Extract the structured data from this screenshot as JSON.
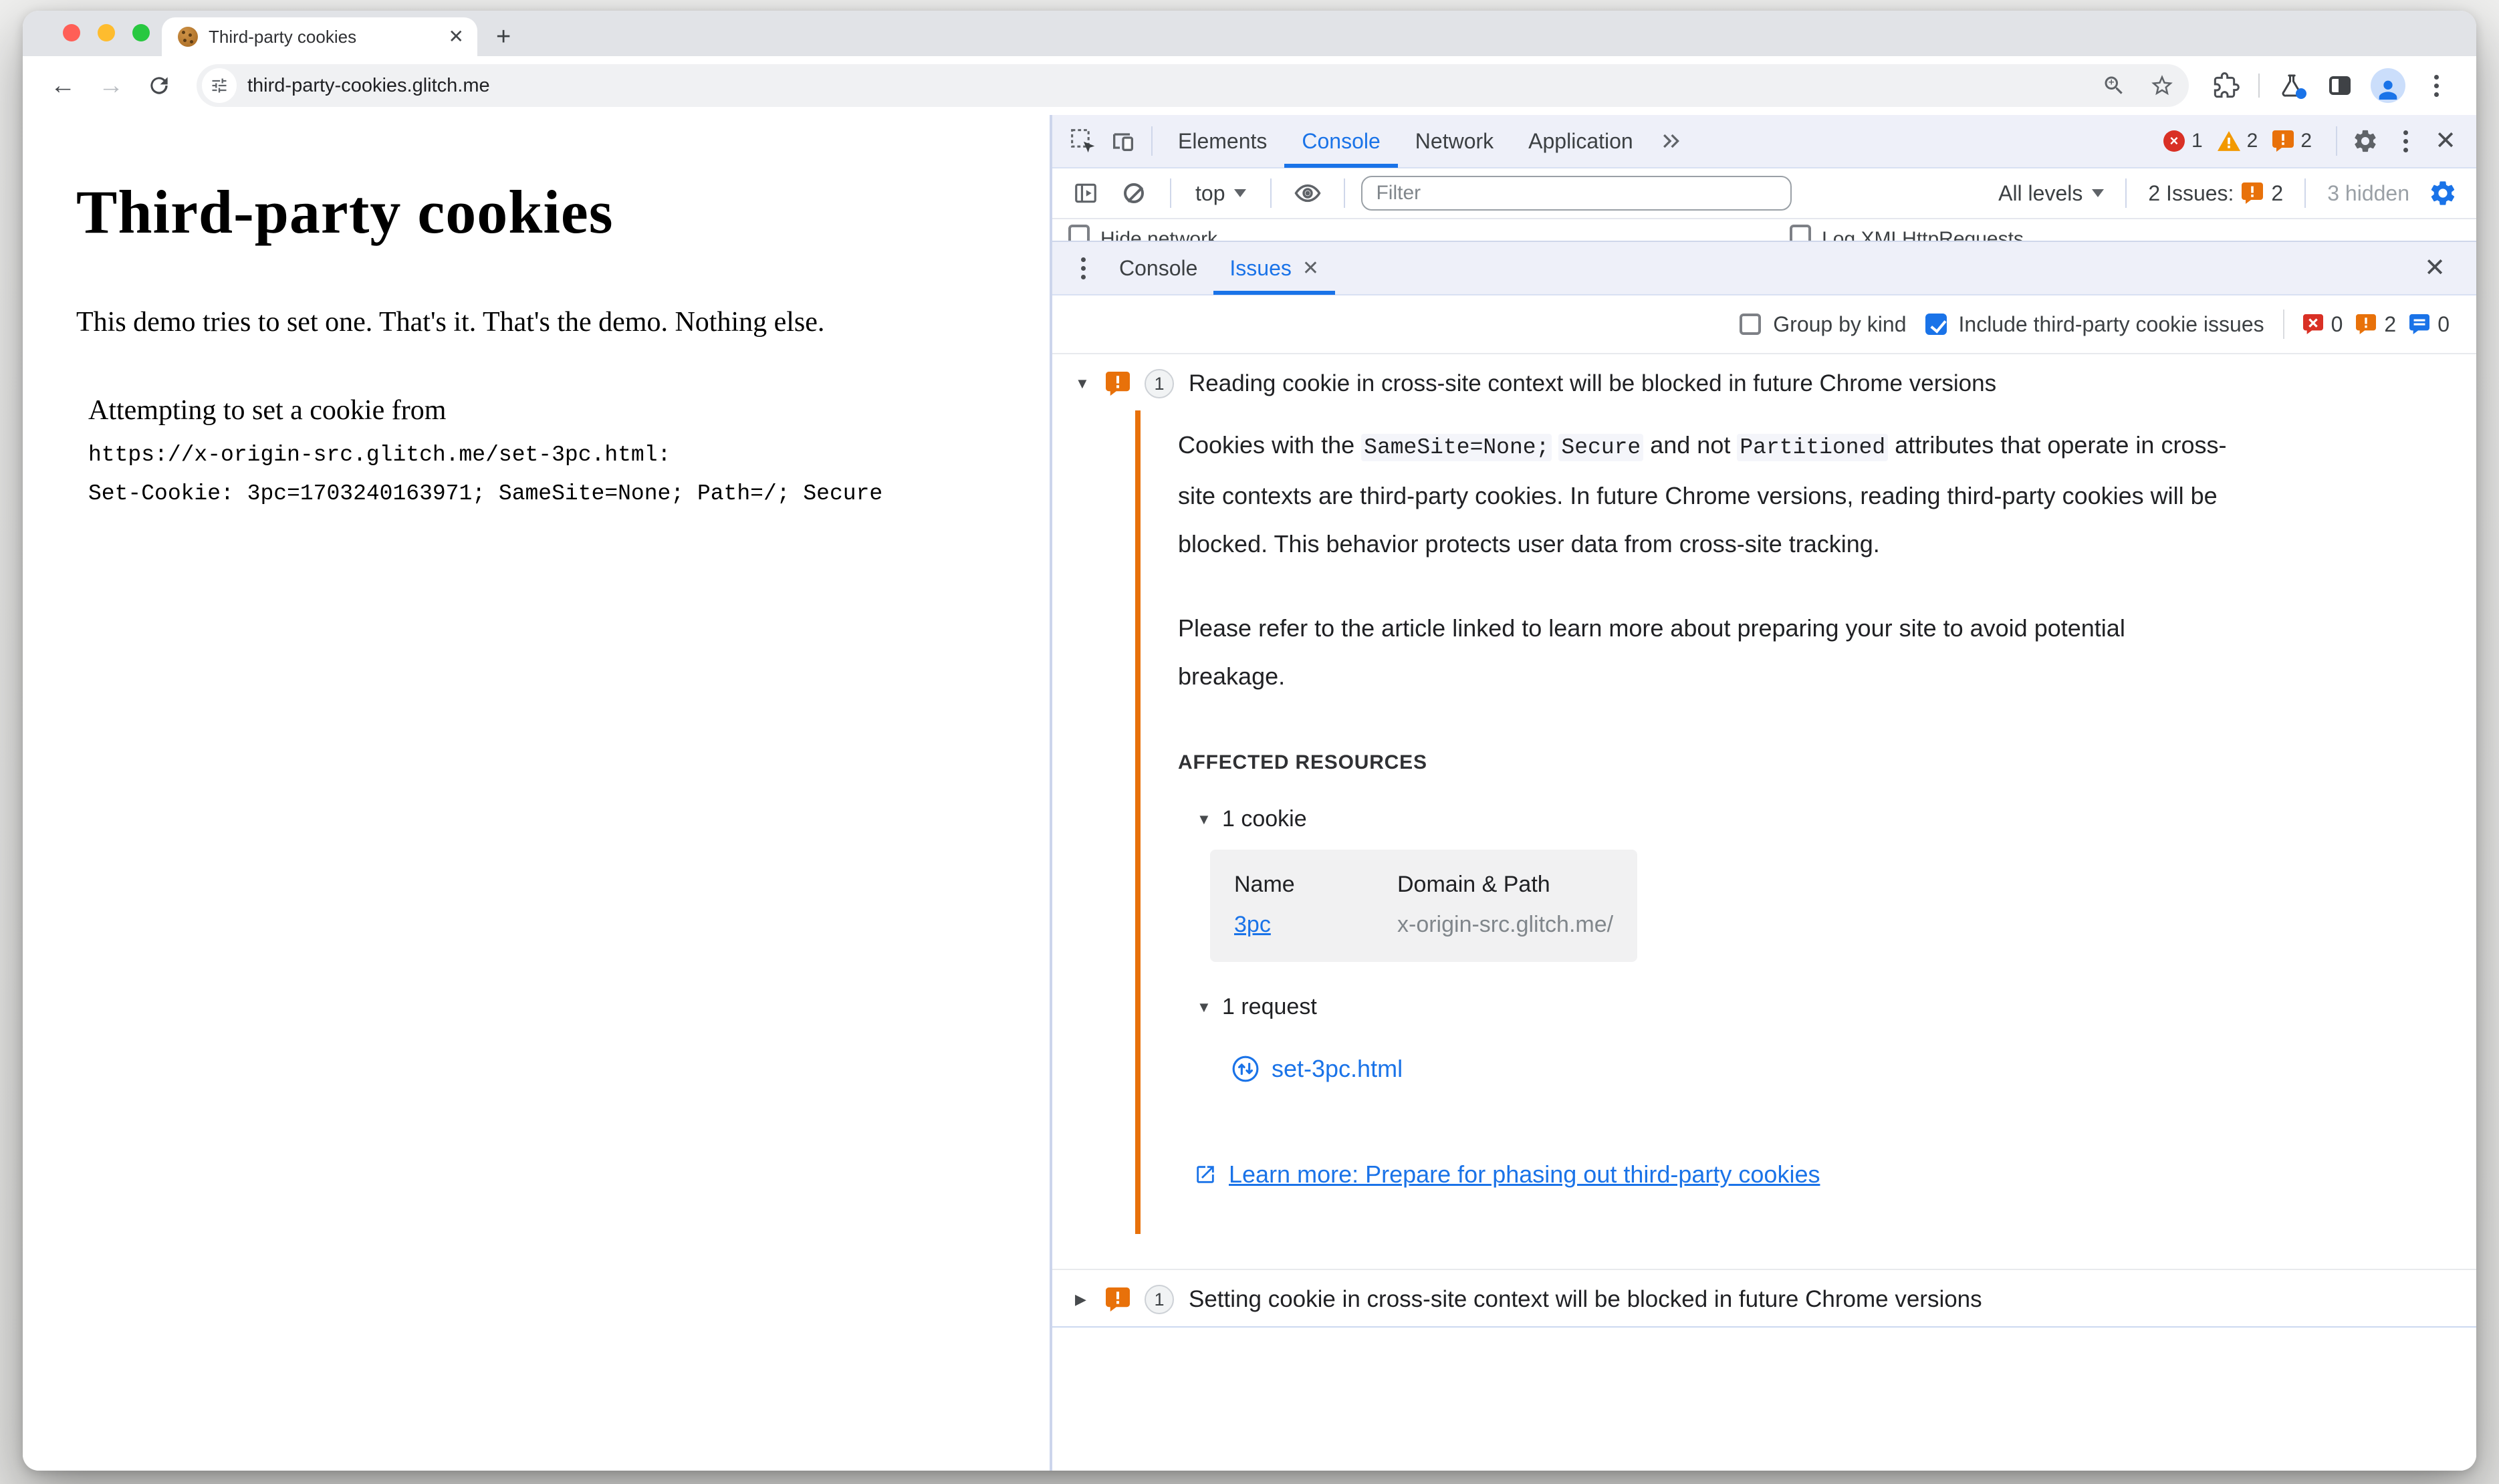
{
  "browser": {
    "tab_title": "Third-party cookies",
    "new_tab_label": "+",
    "tab_close_label": "✕",
    "url": "third-party-cookies.glitch.me",
    "back_arrow": "←",
    "forward_arrow": "→"
  },
  "page": {
    "heading": "Third-party cookies",
    "intro": "This demo tries to set one. That's it. That's the demo. Nothing else.",
    "attempt_label": "Attempting to set a cookie from",
    "attempt_url": "https://x-origin-src.glitch.me/set-3pc.html:",
    "set_cookie_line": "Set-Cookie: 3pc=1703240163971; SameSite=None; Path=/; Secure"
  },
  "devtools": {
    "tabs": [
      "Elements",
      "Console",
      "Network",
      "Application"
    ],
    "selected_tab": "Console",
    "badge_counts": {
      "errors": "1",
      "warnings": "2",
      "issues": "2"
    },
    "close_label": "✕",
    "console_toolbar": {
      "context": "top",
      "filter_placeholder": "Filter",
      "levels": "All levels",
      "issues_label": "2 Issues:",
      "issues_badge": "2",
      "hidden_label": "3 hidden"
    },
    "settings_row": {
      "hide_network": "Hide network",
      "log_xhr": "Log XMLHttpRequests"
    },
    "drawer": {
      "console_tab": "Console",
      "issues_tab": "Issues",
      "issues_tab_close": "✕",
      "drawer_close": "✕"
    },
    "issues_toolbar": {
      "group_by_kind_label": "Group by kind",
      "group_by_kind_checked": false,
      "include_third_party_label": "Include third-party cookie issues",
      "include_third_party_checked": true,
      "counts": {
        "errors": "0",
        "warnings": "2",
        "messages": "0"
      }
    },
    "issue1": {
      "expanded": true,
      "caret": "▼",
      "count": "1",
      "title": "Reading cookie in cross-site context will be blocked in future Chrome versions",
      "p1_a": "Cookies with the ",
      "p1_code1": "SameSite=None;",
      "p1_code2": "Secure",
      "p1_b": " and not ",
      "p1_code3": "Partitioned",
      "p1_c": " attributes that operate in cross-site contexts are third-party cookies. In future Chrome versions, reading third-party cookies will be blocked. This behavior protects user data from cross-site tracking.",
      "p2": "Please refer to the article linked to learn more about preparing your site to avoid potential breakage.",
      "affected_resources_label": "AFFECTED RESOURCES",
      "cookie_section_caret": "▼",
      "cookie_section": "1 cookie",
      "table": {
        "col_name": "Name",
        "col_domain": "Domain & Path",
        "cookie_name": "3pc",
        "cookie_domain": "x-origin-src.glitch.me/"
      },
      "request_section_caret": "▼",
      "request_section": "1 request",
      "request_file": "set-3pc.html",
      "learn_more": "Learn more: Prepare for phasing out third-party cookies"
    },
    "issue2": {
      "expanded": false,
      "caret": "▶",
      "count": "1",
      "title": "Setting cookie in cross-site context will be blocked in future Chrome versions"
    }
  },
  "colors": {
    "accent_blue": "#1a73e8",
    "issue_orange": "#e8710a",
    "warning_orange": "#f29900",
    "error_red": "#d93025",
    "traffic_red": "#ff5f57",
    "traffic_yellow": "#febc2e",
    "traffic_green": "#28c840"
  }
}
